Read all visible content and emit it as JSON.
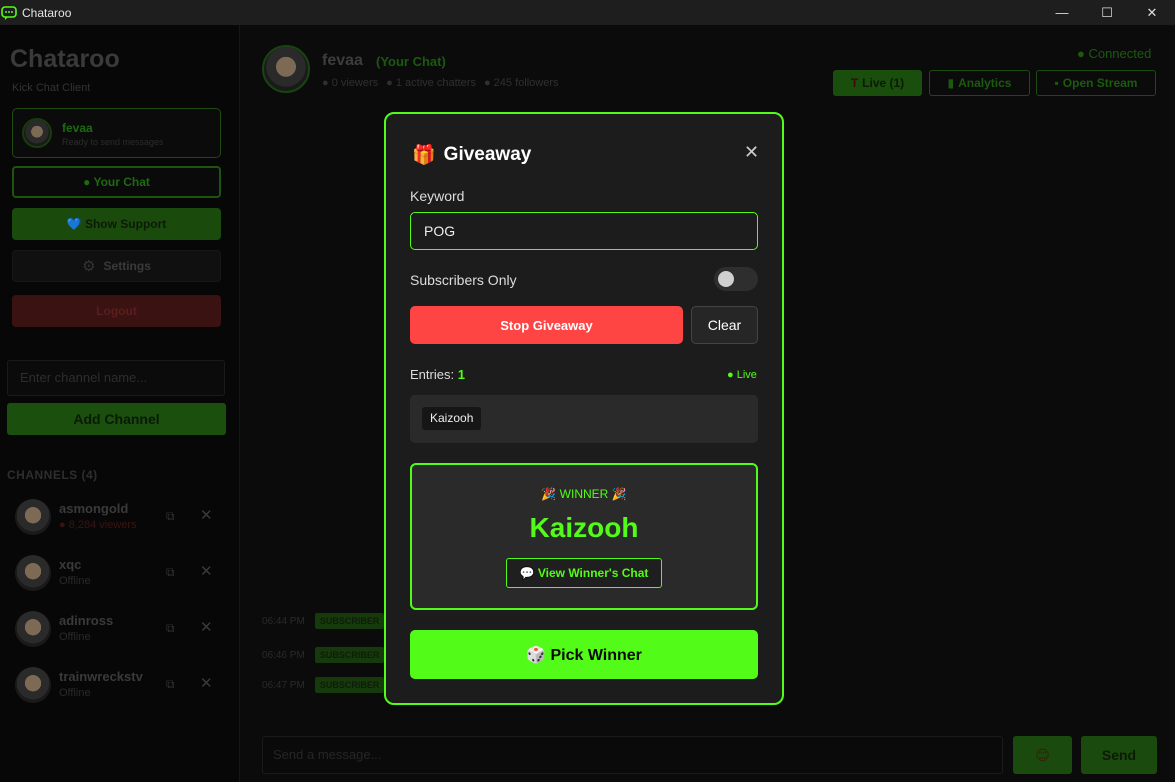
{
  "window": {
    "title": "Chataroo",
    "minimize": "—",
    "maximize": "☐",
    "close": "✕"
  },
  "sidebar": {
    "brand": "Chataroo",
    "subtitle": "Kick Chat Client",
    "profile": {
      "name": "fevaa",
      "status": "Ready to send messages"
    },
    "your_chat": "● Your Chat",
    "show_support": "💙 Show Support",
    "settings": "Settings",
    "logout": "Logout",
    "channel_placeholder": "Enter channel name...",
    "add_channel": "Add Channel",
    "channels_title": "CHANNELS (4)",
    "channels": [
      {
        "name": "asmongold",
        "sub": "● 8,284 viewers"
      },
      {
        "name": "xqc",
        "sub": "Offline"
      },
      {
        "name": "adinross",
        "sub": "Offline"
      },
      {
        "name": "trainwreckstv",
        "sub": "Offline"
      }
    ]
  },
  "header": {
    "name": "fevaa",
    "tag": "(Your Chat)",
    "viewers": "● 0 viewers",
    "chatters": "● 1 active chatters",
    "followers": "● 245 followers",
    "connected": "● Connected",
    "live_btn": "Live (1)",
    "analytics_btn": "Analytics",
    "open_stream_btn": "Open Stream"
  },
  "chat": {
    "rows": [
      {
        "time": "06:44 PM",
        "badge": "SUBSCRIBER"
      },
      {
        "time": "06:46 PM",
        "badge": "SUBSCRIBER"
      },
      {
        "time": "06:47 PM",
        "badge": "SUBSCRIBER"
      }
    ],
    "composer_placeholder": "Send a message...",
    "emoji": "😊",
    "send": "Send"
  },
  "giveaway": {
    "icon": "🎁",
    "title": "Giveaway",
    "close": "✕",
    "keyword_label": "Keyword",
    "keyword_value": "POG",
    "subs_only_label": "Subscribers Only",
    "subs_only": false,
    "stop_btn": "Stop Giveaway",
    "clear_btn": "Clear",
    "entries_label": "Entries:",
    "entries_count": "1",
    "live_label": "● Live",
    "entries": [
      "Kaizooh"
    ],
    "winner_label": "🎉 WINNER 🎉",
    "winner_name": "Kaizooh",
    "view_chat_btn": "💬 View Winner's Chat",
    "pick_btn": "🎲 Pick Winner"
  },
  "colors": {
    "accent": "#53fc18",
    "danger": "#ff4444",
    "panel": "#1c1c1c"
  }
}
